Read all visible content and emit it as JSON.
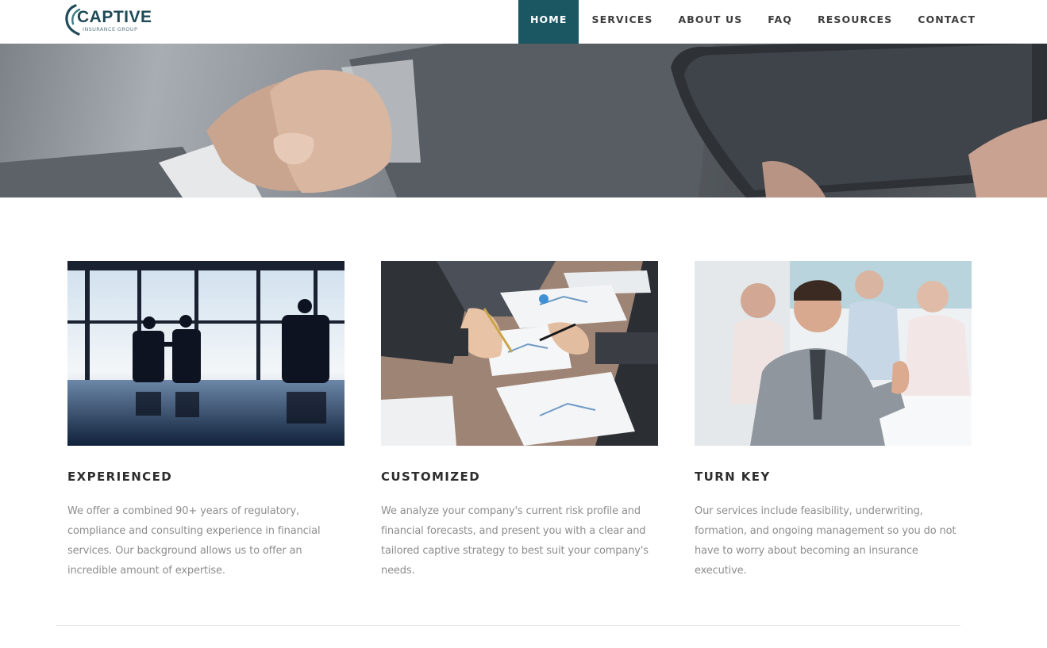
{
  "brand": {
    "name": "CAPTIVE",
    "tagline": "INSURANCE GROUP"
  },
  "nav": {
    "items": [
      {
        "label": "HOME",
        "active": true
      },
      {
        "label": "SERVICES",
        "active": false
      },
      {
        "label": "ABOUT US",
        "active": false
      },
      {
        "label": "FAQ",
        "active": false
      },
      {
        "label": "RESOURCES",
        "active": false
      },
      {
        "label": "CONTACT",
        "active": false
      }
    ]
  },
  "colors": {
    "accent": "#1b5663",
    "heading": "#2d2d2d",
    "body_text": "#8e8e8e"
  },
  "features": [
    {
      "title": "EXPERIENCED",
      "text": "We offer a combined 90+ years of regulatory, compliance and consulting experience in financial services. Our background allows us to offer an incredible amount of expertise."
    },
    {
      "title": "CUSTOMIZED",
      "text": "We analyze your company's current risk profile and financial forecasts, and present you with a clear and tailored captive strategy to best suit your company's needs."
    },
    {
      "title": "TURN KEY",
      "text": "Our services include feasibility, underwriting, formation, and ongoing management so you do not have to worry about becoming an insurance executive."
    }
  ]
}
